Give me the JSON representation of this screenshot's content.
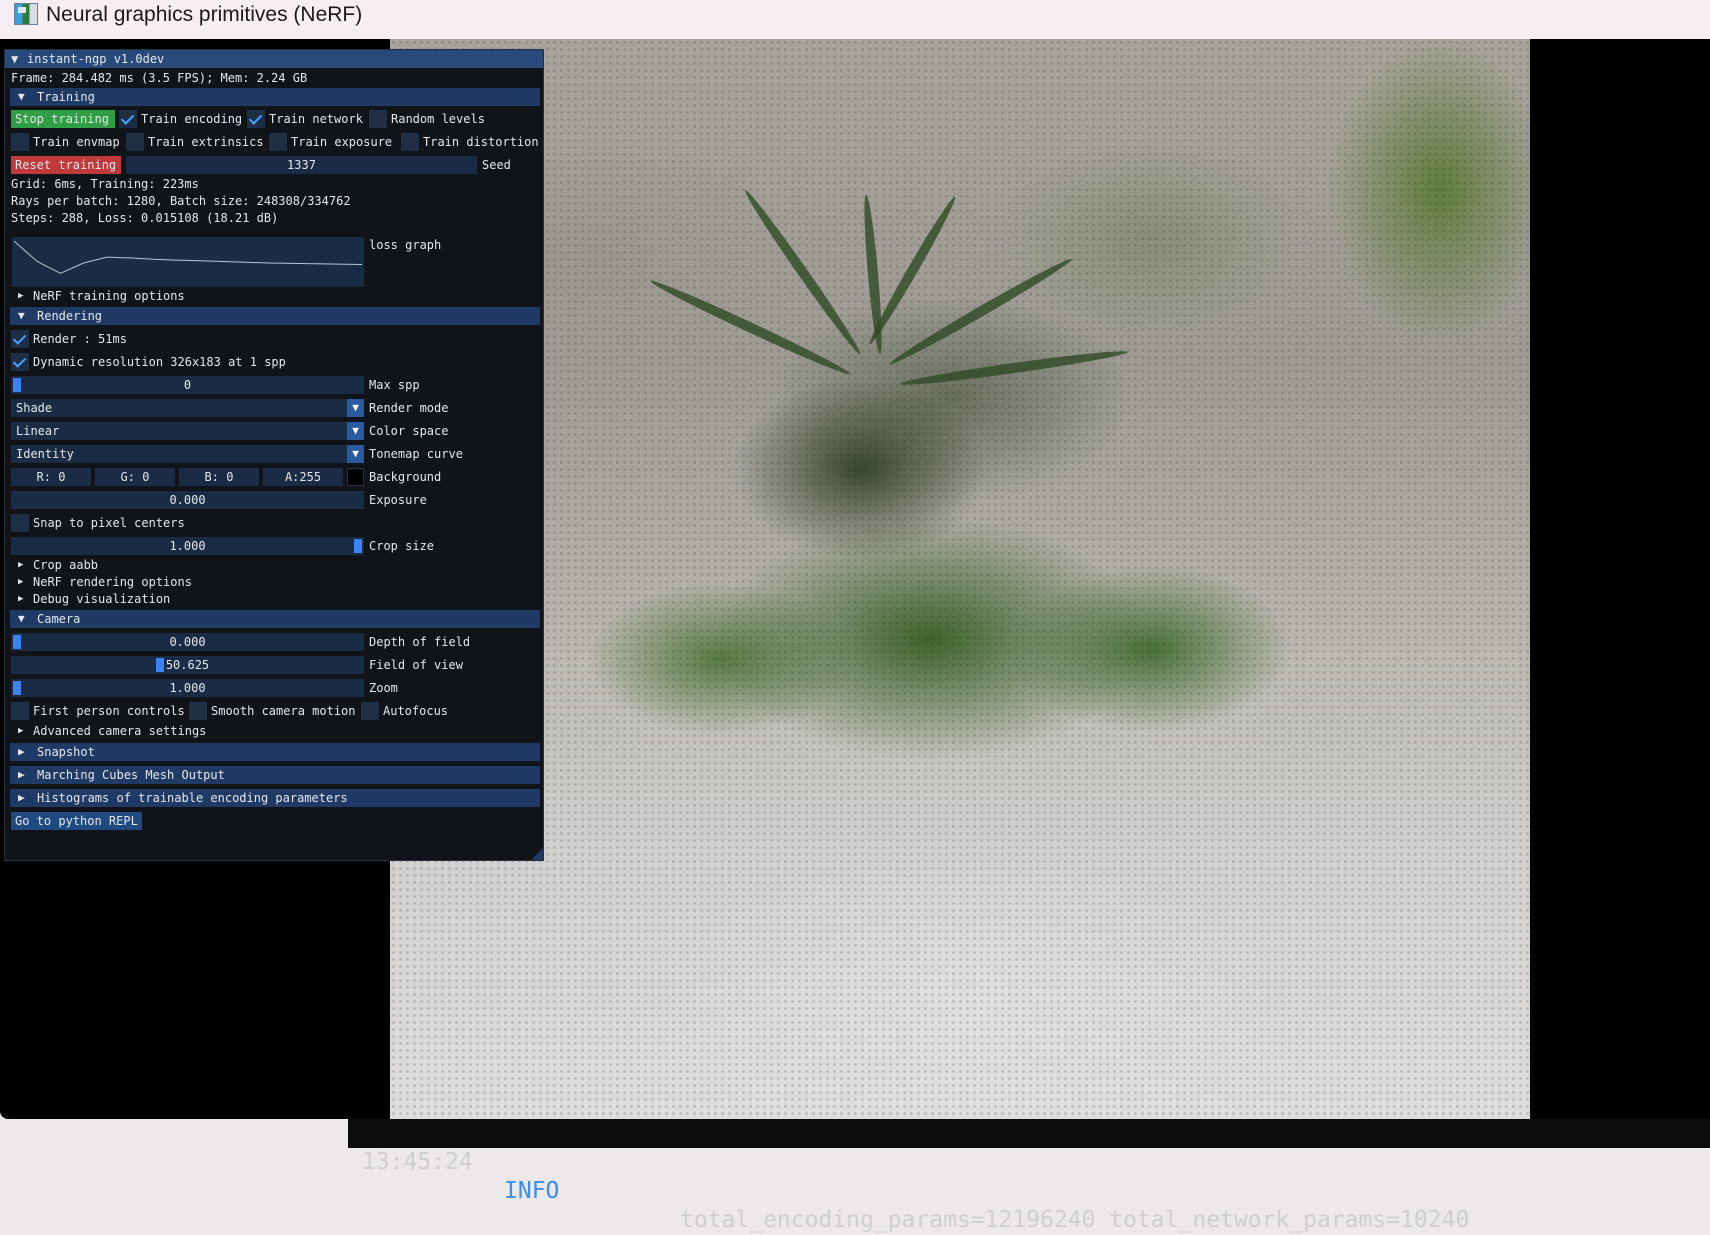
{
  "window": {
    "title": "Neural graphics primitives (NeRF)"
  },
  "panel": {
    "title": "instant-ngp v1.0dev",
    "frame_info": "Frame: 284.482 ms (3.5 FPS); Mem: 2.24 GB",
    "training": {
      "header": "Training",
      "stop_button": "Stop training",
      "train_encoding": {
        "label": "Train encoding",
        "checked": true
      },
      "train_network": {
        "label": "Train network",
        "checked": true
      },
      "random_levels": {
        "label": "Random levels",
        "checked": false
      },
      "train_envmap": {
        "label": "Train envmap",
        "checked": false
      },
      "train_extrinsics": {
        "label": "Train extrinsics",
        "checked": false
      },
      "train_exposure": {
        "label": "Train exposure",
        "checked": false
      },
      "train_distortion": {
        "label": "Train distortion",
        "checked": false
      },
      "reset_button": "Reset training",
      "seed_value": "1337",
      "seed_label": "Seed",
      "grid_stats": "Grid: 6ms, Training: 223ms",
      "rays_stats": "Rays per batch: 1280, Batch size: 248308/334762",
      "steps_stats": "Steps: 288, Loss: 0.015108 (18.21 dB)",
      "loss_graph_label": "loss graph",
      "loss_graph_values": [
        0.06,
        0.032,
        0.016,
        0.03,
        0.038,
        0.037,
        0.035,
        0.034,
        0.033,
        0.032,
        0.031,
        0.03,
        0.0295,
        0.029,
        0.0285,
        0.028
      ],
      "nerf_training_options": "NeRF training options"
    },
    "rendering": {
      "header": "Rendering",
      "render": {
        "label": "Render : 51ms",
        "checked": true
      },
      "dynamic_resolution": {
        "label": "Dynamic resolution 326x183 at 1 spp",
        "checked": true
      },
      "max_spp": {
        "value": "0",
        "label": "Max spp",
        "level": 0.0
      },
      "render_mode": {
        "value": "Shade",
        "label": "Render mode"
      },
      "color_space": {
        "value": "Linear",
        "label": "Color space"
      },
      "tonemap_curve": {
        "value": "Identity",
        "label": "Tonemap curve"
      },
      "background": {
        "r": "R:  0",
        "g": "G:  0",
        "b": "B:  0",
        "a": "A:255",
        "label": "Background",
        "swatch": "#000000"
      },
      "exposure": {
        "value": "0.000",
        "label": "Exposure"
      },
      "snap_to_pixel_centers": {
        "label": "Snap to pixel centers",
        "checked": false
      },
      "crop_size": {
        "value": "1.000",
        "label": "Crop size",
        "level": 1.0
      },
      "crop_aabb": "Crop aabb",
      "nerf_rendering_options": "NeRF rendering options",
      "debug_visualization": "Debug visualization"
    },
    "camera": {
      "header": "Camera",
      "depth_of_field": {
        "value": "0.000",
        "label": "Depth of field",
        "level": 0.0
      },
      "field_of_view": {
        "value": "50.625",
        "label": "Field of view",
        "level": 0.42
      },
      "zoom": {
        "value": "1.000",
        "label": "Zoom",
        "level": 0.0
      },
      "first_person_controls": {
        "label": "First person controls",
        "checked": false
      },
      "smooth_camera_motion": {
        "label": "Smooth camera motion",
        "checked": false
      },
      "autofocus": {
        "label": "Autofocus",
        "checked": false
      },
      "advanced_camera_settings": "Advanced camera settings"
    },
    "snapshot_header": "Snapshot",
    "marching_cubes_header": "Marching Cubes Mesh Output",
    "histograms_header": "Histograms of trainable encoding parameters",
    "python_repl_button": "Go to python REPL"
  },
  "log": {
    "time": "13:45:24",
    "level": "INFO",
    "message": "total_encoding_params=12196240 total_network_params=10240"
  },
  "colors": {
    "panel_bg": "#101419",
    "header_bg": "#1f3a64",
    "frame_bg": "#1a2c45",
    "slider_grab": "#3b82f6",
    "stop_button": "#2f9e44",
    "reset_button": "#c0393b",
    "checkmark": "#4da0ff",
    "log_info": "#3b8eea"
  },
  "icons": [
    "app-icon",
    "collapse-triangle-icon",
    "expand-triangle-icon",
    "checkmark-icon",
    "combo-arrow-icon",
    "resize-grip-icon"
  ]
}
